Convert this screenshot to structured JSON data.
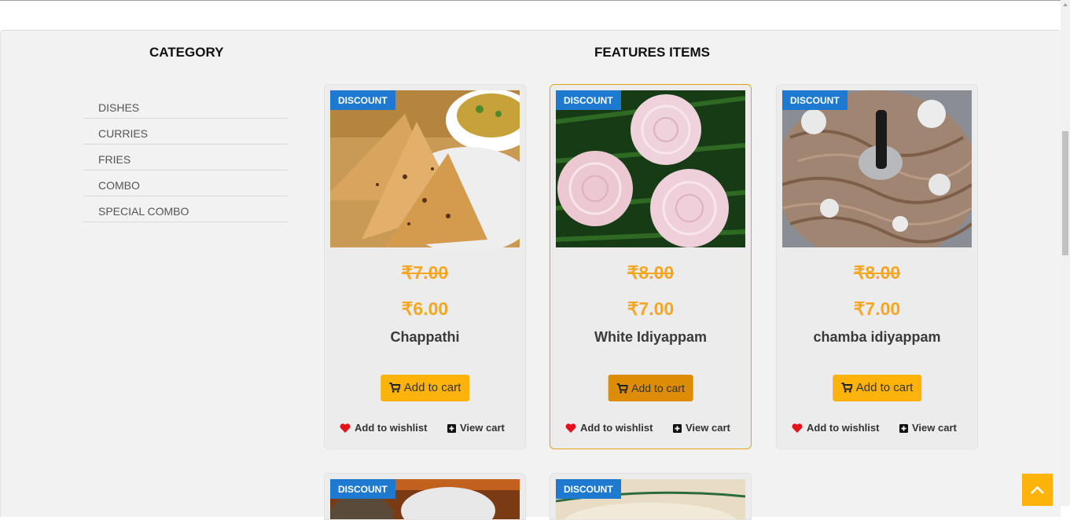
{
  "category": {
    "heading": "CATEGORY",
    "items": [
      {
        "label": "DISHES"
      },
      {
        "label": "CURRIES"
      },
      {
        "label": "FRIES"
      },
      {
        "label": "COMBO"
      },
      {
        "label": "SPECIAL COMBO"
      }
    ]
  },
  "features": {
    "heading": "FEATURES ITEMS",
    "products": [
      {
        "badge": "DISCOUNT",
        "old_price": "₹7.00",
        "price": "₹6.00",
        "name": "Chappathi",
        "add_to_cart": "Add to cart",
        "wishlist": "Add to wishlist",
        "view_cart": "View cart"
      },
      {
        "badge": "DISCOUNT",
        "old_price": "₹8.00",
        "price": "₹7.00",
        "name": "White Idiyappam",
        "add_to_cart": "Add to cart",
        "wishlist": "Add to wishlist",
        "view_cart": "View cart"
      },
      {
        "badge": "DISCOUNT",
        "old_price": "₹8.00",
        "price": "₹7.00",
        "name": "chamba idiyappam",
        "add_to_cart": "Add to cart",
        "wishlist": "Add to wishlist",
        "view_cart": "View cart"
      },
      {
        "badge": "DISCOUNT"
      },
      {
        "badge": "DISCOUNT"
      }
    ]
  },
  "colors": {
    "accent": "#feb30a",
    "price": "#f5a623",
    "badge": "#1e7ad1",
    "highlight_border": "#e0a21c"
  },
  "icons": {
    "cart": "shopping-cart-icon",
    "wishlist": "heart-icon",
    "view_cart": "plus-square-icon",
    "back_to_top": "chevron-up-icon"
  }
}
